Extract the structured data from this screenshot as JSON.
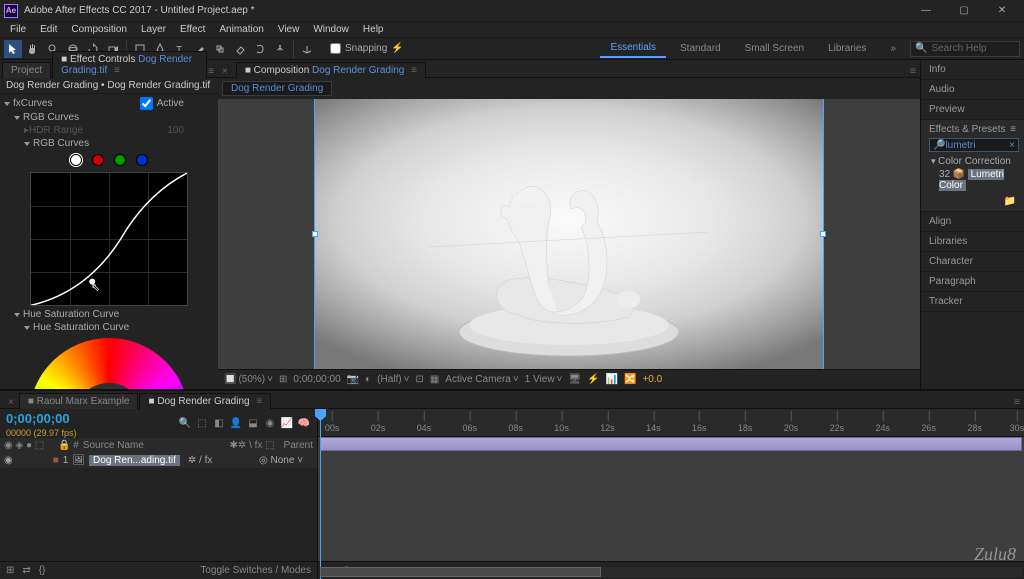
{
  "title": "Adobe After Effects CC 2017 - Untitled Project.aep *",
  "menu": [
    "File",
    "Edit",
    "Composition",
    "Layer",
    "Effect",
    "Animation",
    "View",
    "Window",
    "Help"
  ],
  "snapping_label": "Snapping",
  "workspaces": [
    "Essentials",
    "Standard",
    "Small Screen",
    "Libraries"
  ],
  "workspace_active": "Essentials",
  "search_placeholder": "Search Help",
  "left_tabs": {
    "project": "Project",
    "effect_controls": "Effect Controls",
    "ec_file": "Dog Render Grading.tif"
  },
  "ec_breadcrumb": {
    "comp": "Dog Render Grading",
    "layer": "Dog Render Grading.tif"
  },
  "effect": {
    "name": "Curves",
    "active_label": "Active",
    "rgb_curves": "RGB Curves",
    "hdr_range": "HDR Range",
    "hdr_value": "100",
    "rgb_curves2": "RGB Curves",
    "hue_sat": "Hue Saturation Curve",
    "hue_sat2": "Hue Saturation Curve"
  },
  "comp_panel": {
    "label": "Composition",
    "name": "Dog Render Grading",
    "footage": "Dog Render Grading"
  },
  "viewer_toolbar": {
    "zoom": "(50%)",
    "timecode": "0;00;00;00",
    "res": "(Half)",
    "camera": "Active Camera",
    "view": "1 View",
    "exposure": "+0.0"
  },
  "right_panels": {
    "info": "Info",
    "audio": "Audio",
    "preview": "Preview",
    "effects_presets": "Effects & Presets",
    "search_value": "lumetri",
    "tree_cat": "Color Correction",
    "tree_item": "Lumetri Color",
    "align": "Align",
    "libraries": "Libraries",
    "character": "Character",
    "paragraph": "Paragraph",
    "tracker": "Tracker"
  },
  "timeline": {
    "tabs": [
      "Raoul Marx Example",
      "Dog Render Grading"
    ],
    "active_tab": "Dog Render Grading",
    "timecode": "0;00;00;00",
    "frame": "00000 (29.97 fps)",
    "col_source": "Source Name",
    "col_parent": "Parent",
    "layer_num": "1",
    "layer_name": "Dog Ren...ading.tif",
    "layer_parent": "None",
    "ticks": [
      "00s",
      "02s",
      "04s",
      "06s",
      "08s",
      "10s",
      "12s",
      "14s",
      "16s",
      "18s",
      "20s",
      "22s",
      "24s",
      "26s",
      "28s",
      "30s"
    ],
    "toggle_label": "Toggle Switches / Modes"
  },
  "watermark": "Zulu8"
}
